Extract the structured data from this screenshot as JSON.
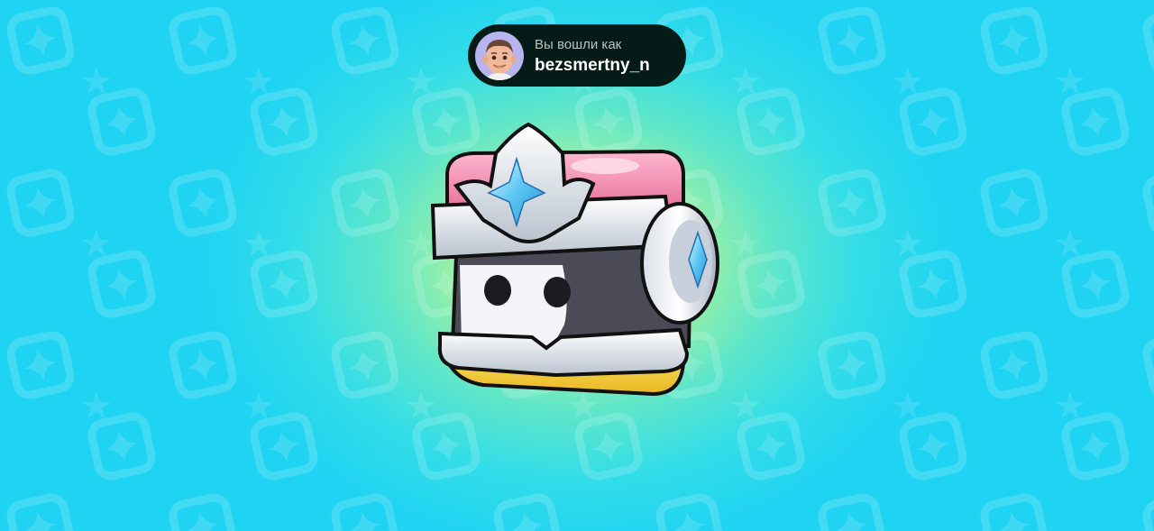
{
  "login": {
    "caption": "Вы вошли как",
    "username": "bezsmertny_n",
    "avatar": "memoji-avatar-icon"
  },
  "reward": {
    "item": "starr-drop-chest-icon"
  },
  "colors": {
    "background_center": "#e6ff73",
    "background_edge": "#1fd3f2",
    "pill_background": "#051b17",
    "chest_lid": "#ec7fa6",
    "chest_base": "#f1cd31",
    "gem": "#5bc6f3"
  }
}
